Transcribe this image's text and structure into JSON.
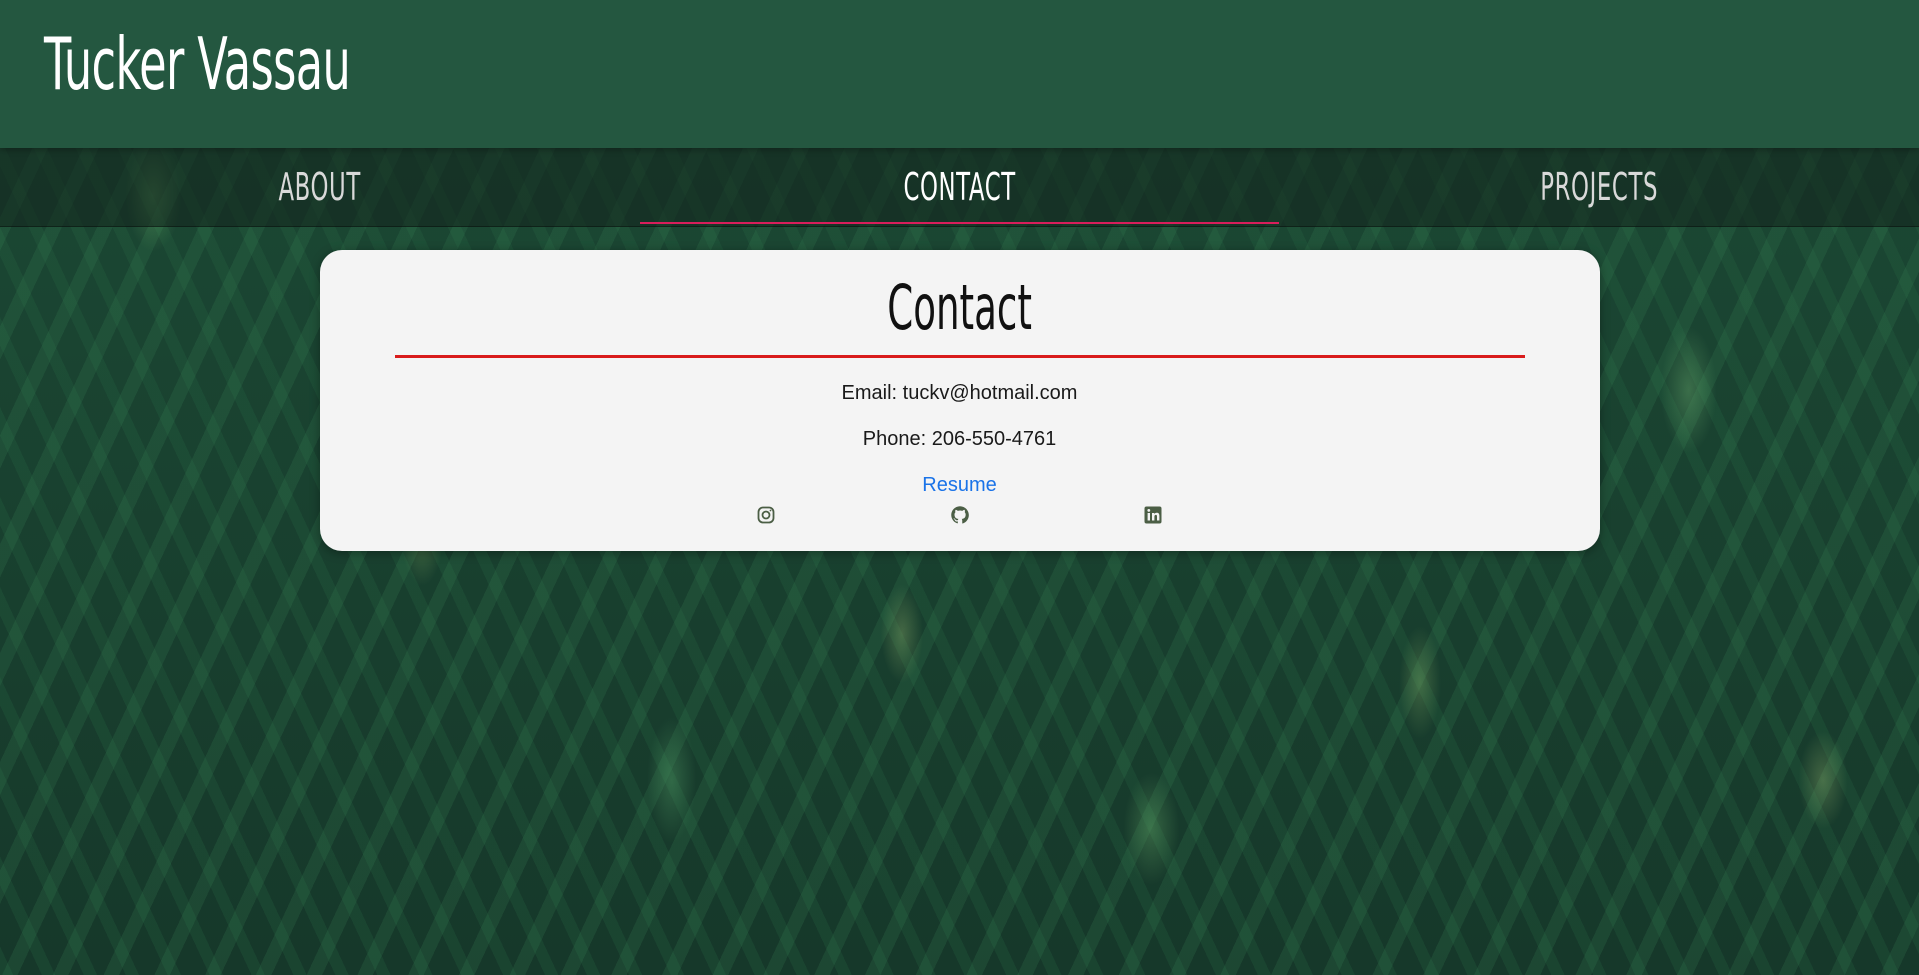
{
  "header": {
    "title": "Tucker Vassau"
  },
  "nav": {
    "items": [
      {
        "label": "About"
      },
      {
        "label": "Contact",
        "active": true
      },
      {
        "label": "Projects"
      }
    ]
  },
  "contact": {
    "title": "Contact",
    "email_text": "Email: tuckv@hotmail.com",
    "phone_text": "Phone: 206-550-4761",
    "resume_label": "Resume",
    "socials": [
      "instagram-icon",
      "github-icon",
      "linkedin-icon"
    ]
  },
  "colors": {
    "header_bg": "#245740",
    "card_bg": "#f4f4f4",
    "accent_underline": "#d81e5b",
    "title_rule": "#d91c1c",
    "link": "#1a73e8",
    "icon": "#4b5e45"
  }
}
